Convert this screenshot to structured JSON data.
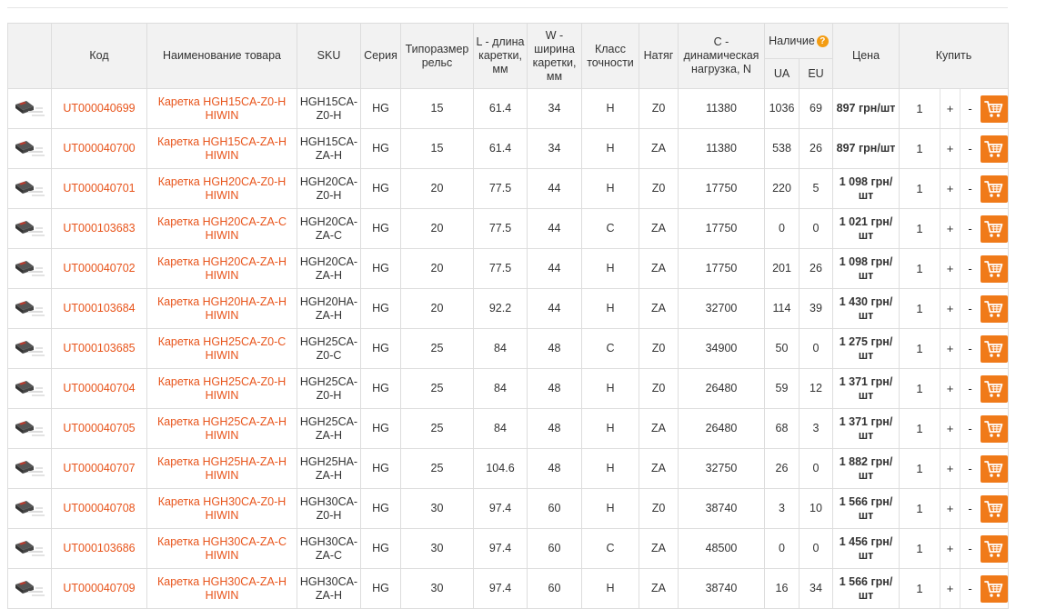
{
  "table": {
    "headers": {
      "code": "Код",
      "name": "Наименование товара",
      "sku": "SKU",
      "series": "Серия",
      "rail_size": "Типоразмер рельс",
      "length": "L - длина каретки, мм",
      "width": "W - ширина каретки, мм",
      "precision": "Класс точности",
      "preload": "Натяг",
      "load": "C - динамическая нагрузка, N",
      "availability": "Наличие",
      "ua": "UA",
      "eu": "EU",
      "price": "Цена",
      "buy": "Купить"
    },
    "plus_label": "+",
    "minus_label": "-",
    "rows": [
      {
        "code": "UT000040699",
        "name": "Каретка HGH15CA-Z0-H HIWIN",
        "sku": "HGH15CA-Z0-H",
        "series": "HG",
        "rail": "15",
        "length": "61.4",
        "width": "34",
        "precision": "H",
        "preload": "Z0",
        "load": "11380",
        "ua": "1036",
        "eu": "69",
        "price": "897 грн/шт",
        "qty": "1"
      },
      {
        "code": "UT000040700",
        "name": "Каретка HGH15CA-ZA-H HIWIN",
        "sku": "HGH15CA-ZA-H",
        "series": "HG",
        "rail": "15",
        "length": "61.4",
        "width": "34",
        "precision": "H",
        "preload": "ZA",
        "load": "11380",
        "ua": "538",
        "eu": "26",
        "price": "897 грн/шт",
        "qty": "1"
      },
      {
        "code": "UT000040701",
        "name": "Каретка HGH20CA-Z0-H HIWIN",
        "sku": "HGH20CA-Z0-H",
        "series": "HG",
        "rail": "20",
        "length": "77.5",
        "width": "44",
        "precision": "H",
        "preload": "Z0",
        "load": "17750",
        "ua": "220",
        "eu": "5",
        "price": "1 098 грн/шт",
        "qty": "1"
      },
      {
        "code": "UT000103683",
        "name": "Каретка HGH20CA-ZA-C HIWIN",
        "sku": "HGH20CA-ZA-C",
        "series": "HG",
        "rail": "20",
        "length": "77.5",
        "width": "44",
        "precision": "C",
        "preload": "ZA",
        "load": "17750",
        "ua": "0",
        "eu": "0",
        "price": "1 021 грн/шт",
        "qty": "1"
      },
      {
        "code": "UT000040702",
        "name": "Каретка HGH20CA-ZA-H HIWIN",
        "sku": "HGH20CA-ZA-H",
        "series": "HG",
        "rail": "20",
        "length": "77.5",
        "width": "44",
        "precision": "H",
        "preload": "ZA",
        "load": "17750",
        "ua": "201",
        "eu": "26",
        "price": "1 098 грн/шт",
        "qty": "1"
      },
      {
        "code": "UT000103684",
        "name": "Каретка HGH20HA-ZA-H HIWIN",
        "sku": "HGH20HA-ZA-H",
        "series": "HG",
        "rail": "20",
        "length": "92.2",
        "width": "44",
        "precision": "H",
        "preload": "ZA",
        "load": "32700",
        "ua": "114",
        "eu": "39",
        "price": "1 430 грн/шт",
        "qty": "1"
      },
      {
        "code": "UT000103685",
        "name": "Каретка HGH25CA-Z0-C HIWIN",
        "sku": "HGH25CA-Z0-C",
        "series": "HG",
        "rail": "25",
        "length": "84",
        "width": "48",
        "precision": "C",
        "preload": "Z0",
        "load": "34900",
        "ua": "50",
        "eu": "0",
        "price": "1 275 грн/шт",
        "qty": "1"
      },
      {
        "code": "UT000040704",
        "name": "Каретка HGH25CA-Z0-H HIWIN",
        "sku": "HGH25CA-Z0-H",
        "series": "HG",
        "rail": "25",
        "length": "84",
        "width": "48",
        "precision": "H",
        "preload": "Z0",
        "load": "26480",
        "ua": "59",
        "eu": "12",
        "price": "1 371 грн/шт",
        "qty": "1"
      },
      {
        "code": "UT000040705",
        "name": "Каретка HGH25CA-ZA-H HIWIN",
        "sku": "HGH25CA-ZA-H",
        "series": "HG",
        "rail": "25",
        "length": "84",
        "width": "48",
        "precision": "H",
        "preload": "ZA",
        "load": "26480",
        "ua": "68",
        "eu": "3",
        "price": "1 371 грн/шт",
        "qty": "1"
      },
      {
        "code": "UT000040707",
        "name": "Каретка HGH25HA-ZA-H HIWIN",
        "sku": "HGH25HA-ZA-H",
        "series": "HG",
        "rail": "25",
        "length": "104.6",
        "width": "48",
        "precision": "H",
        "preload": "ZA",
        "load": "32750",
        "ua": "26",
        "eu": "0",
        "price": "1 882 грн/шт",
        "qty": "1"
      },
      {
        "code": "UT000040708",
        "name": "Каретка HGH30CA-Z0-H HIWIN",
        "sku": "HGH30CA-Z0-H",
        "series": "HG",
        "rail": "30",
        "length": "97.4",
        "width": "60",
        "precision": "H",
        "preload": "Z0",
        "load": "38740",
        "ua": "3",
        "eu": "10",
        "price": "1 566 грн/шт",
        "qty": "1"
      },
      {
        "code": "UT000103686",
        "name": "Каретка HGH30CA-ZA-C HIWIN",
        "sku": "HGH30CA-ZA-C",
        "series": "HG",
        "rail": "30",
        "length": "97.4",
        "width": "60",
        "precision": "C",
        "preload": "ZA",
        "load": "48500",
        "ua": "0",
        "eu": "0",
        "price": "1 456 грн/шт",
        "qty": "1"
      },
      {
        "code": "UT000040709",
        "name": "Каретка HGH30CA-ZA-H HIWIN",
        "sku": "HGH30CA-ZA-H",
        "series": "HG",
        "rail": "30",
        "length": "97.4",
        "width": "60",
        "precision": "H",
        "preload": "ZA",
        "load": "38740",
        "ua": "16",
        "eu": "34",
        "price": "1 566 грн/шт",
        "qty": "1"
      }
    ]
  },
  "icons": {
    "help": "question-circle-icon",
    "cart": "shopping-cart-icon",
    "product": "product-thumbnail"
  },
  "colors": {
    "link": "#e8541b",
    "cart_button": "#f07a19",
    "help_icon": "#f39c12",
    "header_bg": "#f2f2f2"
  }
}
